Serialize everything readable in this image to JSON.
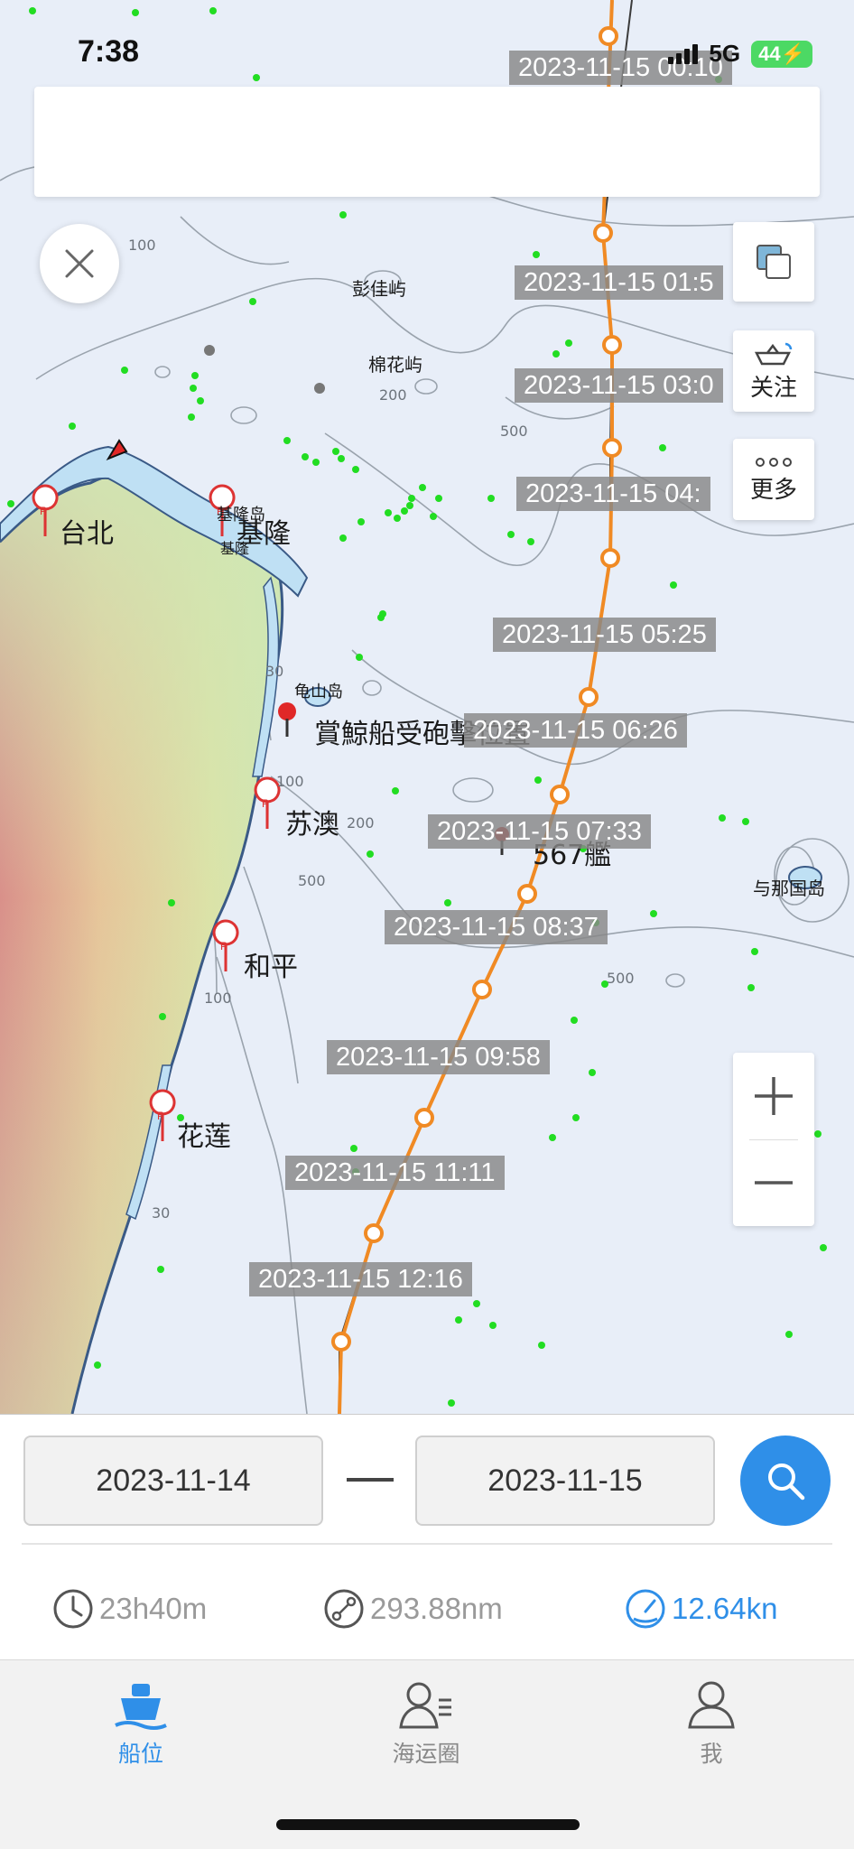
{
  "status_bar": {
    "time": "7:38",
    "network": "5G",
    "battery": "44"
  },
  "map": {
    "controls": {
      "follow_label": "关注",
      "more_label": "更多"
    },
    "places": {
      "pengjia": "彭佳屿",
      "mianhua": "棉花屿",
      "keelung_islet": "基隆岛",
      "taipei": "台北",
      "keelung": "基隆",
      "keelung_small": "基隆",
      "guishan": "龟山岛",
      "shelling": "賞鯨船受砲擊位置",
      "suao": "苏澳",
      "ship_567": "567艦",
      "yonaguni": "与那国岛",
      "heping": "和平",
      "hualien": "花莲"
    },
    "depths": {
      "d100a": "100",
      "d200a": "200",
      "d500a": "500",
      "d30a": "30",
      "d100b": "100",
      "d200b": "200",
      "d500b": "500",
      "d500c": "500",
      "d100c": "100",
      "d30b": "30"
    },
    "track_timestamps": [
      "2023-11-15 00:10",
      "2023-11-15 01:5",
      "2023-11-15 03:0",
      "2023-11-15 04:",
      "2023-11-15 05:25",
      "2023-11-15 06:26",
      "2023-11-15 07:33",
      "2023-11-15 08:37",
      "2023-11-15 09:58",
      "2023-11-15 11:11",
      "2023-11-15 12:16"
    ],
    "colors": {
      "track": "#f08a24",
      "sea": "#e8eef8",
      "vessel_dot": "#22dd22"
    }
  },
  "query": {
    "start_date": "2023-11-14",
    "end_date": "2023-11-15"
  },
  "stats": {
    "duration": "23h40m",
    "distance": "293.88nm",
    "speed": "12.64kn"
  },
  "tabs": [
    {
      "label": "船位"
    },
    {
      "label": "海运圈"
    },
    {
      "label": "我"
    }
  ]
}
